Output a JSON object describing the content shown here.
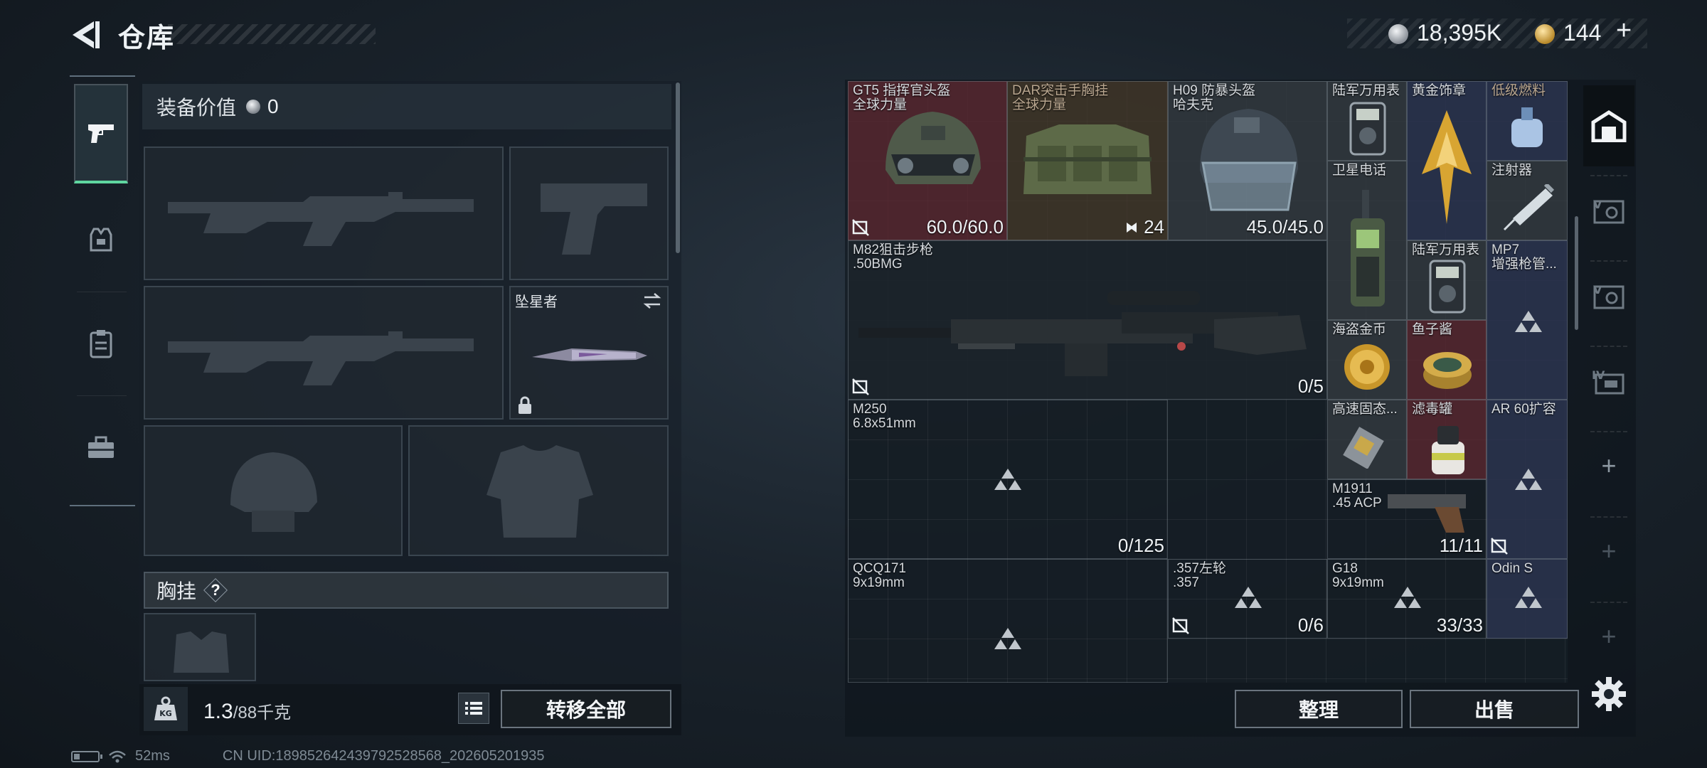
{
  "header": {
    "title": "仓库",
    "back_icon": "back-arrow-icon",
    "currencies": [
      {
        "icon": "silver-coin-icon",
        "value": "18,395K"
      },
      {
        "icon": "gold-coin-icon",
        "value": "144"
      }
    ],
    "add_label": "+"
  },
  "rail": {
    "tabs": [
      {
        "icon": "pistol-icon",
        "active": true
      },
      {
        "icon": "armor-vest-icon",
        "active": false
      },
      {
        "icon": "chest-rig-icon",
        "active": false
      },
      {
        "icon": "briefcase-icon",
        "active": false
      }
    ]
  },
  "loadout": {
    "value_label": "装备价值",
    "value": "0",
    "melee_name": "坠星者",
    "chest_label": "胸挂",
    "help_label": "?",
    "weight_current": "1.3",
    "weight_max": "/88千克",
    "weight_icon_text": "KG",
    "transfer_label": "转移全部"
  },
  "stash": {
    "items": [
      {
        "name": "GT5 指挥官头盔",
        "sub": "全球力量",
        "count": "60.0/60.0"
      },
      {
        "name": "DAR突击手胸挂",
        "sub": "全球力量",
        "count": "24"
      },
      {
        "name": "H09 防暴头盔",
        "sub": "哈夫克",
        "count": "45.0/45.0"
      },
      {
        "name": "陆军万用表"
      },
      {
        "name": "黄金饰章"
      },
      {
        "name": "低级燃料"
      },
      {
        "name": "卫星电话"
      },
      {
        "name": "注射器"
      },
      {
        "name": "M82狙击步枪",
        "sub": ".50BMG",
        "count": "0/5"
      },
      {
        "name": "陆军万用表"
      },
      {
        "name": "MP7",
        "sub": "增强枪管..."
      },
      {
        "name": "海盗金币"
      },
      {
        "name": "鱼子酱"
      },
      {
        "name": "M250",
        "sub": "6.8x51mm",
        "count": "0/125"
      },
      {
        "name": "高速固态..."
      },
      {
        "name": "滤毒罐"
      },
      {
        "name": "AR 60扩容"
      },
      {
        "name": "M1911",
        "sub": ".45 ACP",
        "count": "11/11"
      },
      {
        "name": "QCQ171",
        "sub": "9x19mm"
      },
      {
        "name": ".357左轮",
        "sub": ".357",
        "count": "0/6"
      },
      {
        "name": "G18",
        "sub": "9x19mm",
        "count": "33/33"
      },
      {
        "name": "Odin S"
      }
    ],
    "sort_label": "整理",
    "sell_label": "出售"
  },
  "side_rail": {
    "tabs": [
      {
        "icon": "home-storage-icon",
        "active": true
      },
      {
        "icon": "storage-v-icon"
      },
      {
        "icon": "storage-v-alt-icon"
      },
      {
        "icon": "storage-iv-icon"
      },
      {
        "icon": "add-icon"
      },
      {
        "icon": "add-icon"
      },
      {
        "icon": "add-icon"
      }
    ],
    "add_label": "+",
    "settings_icon": "gear-icon"
  },
  "status": {
    "ping": "52ms",
    "uid": "CN UID:18985264243979252856​8_202605201935"
  }
}
